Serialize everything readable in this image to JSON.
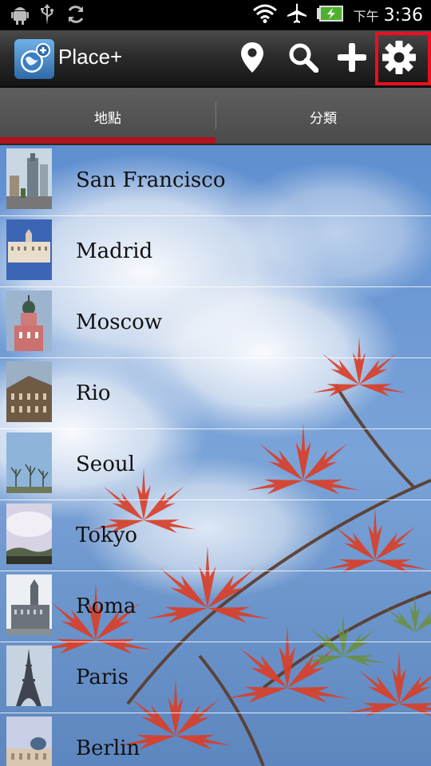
{
  "status_bar": {
    "icons": [
      "android-debug-icon",
      "usb-icon",
      "sync-icon",
      "wifi-icon",
      "airplane-icon",
      "battery-charging-icon"
    ],
    "ampm": "下午",
    "time": "3:36"
  },
  "action_bar": {
    "app_title": "Place+",
    "actions": [
      "location-pin-icon",
      "search-icon",
      "add-icon",
      "settings-gear-icon"
    ],
    "highlight_color": "#ea0f1f"
  },
  "tabs": [
    {
      "label": "地點",
      "selected": true
    },
    {
      "label": "分類",
      "selected": false
    }
  ],
  "colors": {
    "tab_indicator": "#b3131c",
    "sky": "#6b93c9",
    "leaf": "#d8402a"
  },
  "places": [
    {
      "name": "San Francisco"
    },
    {
      "name": "Madrid"
    },
    {
      "name": "Moscow"
    },
    {
      "name": "Rio"
    },
    {
      "name": "Seoul"
    },
    {
      "name": "Tokyo"
    },
    {
      "name": "Roma"
    },
    {
      "name": "Paris"
    },
    {
      "name": "Berlin"
    }
  ]
}
